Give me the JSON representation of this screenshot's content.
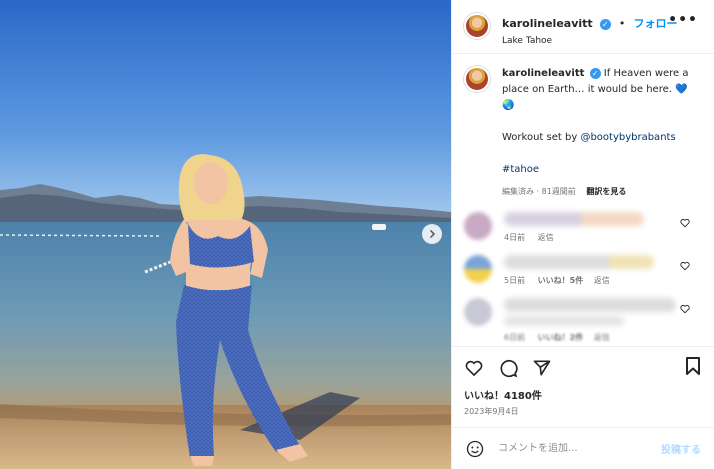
{
  "post": {
    "username": "karolineleavitt",
    "follow_label": "フォロー",
    "separator": "•",
    "location": "Lake Tahoe",
    "more_label": "•••",
    "caption_line1": "If Heaven were a",
    "caption_line2": "place on Earth… it would be here. 💙",
    "caption_line3": "🌏",
    "caption_workout_prefix": "Workout set by ",
    "caption_mention": "@bootybybrabants",
    "caption_hashtag": "#tahoe",
    "caption_meta_edited": "編集済み · 81週間前",
    "caption_meta_translate": "翻訳を見る",
    "likes": "いいね！4180件",
    "date": "2023年9月4日"
  },
  "comments": [
    {
      "time": "4日前",
      "reply": "返信",
      "likes": ""
    },
    {
      "time": "5日前",
      "likes": "いいね！5件",
      "reply": "返信"
    },
    {
      "time": "6日前",
      "likes": "いいね！2件",
      "reply": "返信"
    }
  ],
  "composer": {
    "placeholder": "コメントを追加...",
    "post_label": "投稿する"
  },
  "colors": {
    "link": "#0095f6",
    "verified": "#3897f0",
    "sky_top": "#2a68c9",
    "lake": "#5c8fb3",
    "outfit": "#3c5db0"
  },
  "icons": [
    "verified-badge-icon",
    "more-options-icon",
    "heart-icon",
    "comment-icon",
    "share-icon",
    "bookmark-icon",
    "emoji-icon",
    "chevron-right-icon"
  ]
}
